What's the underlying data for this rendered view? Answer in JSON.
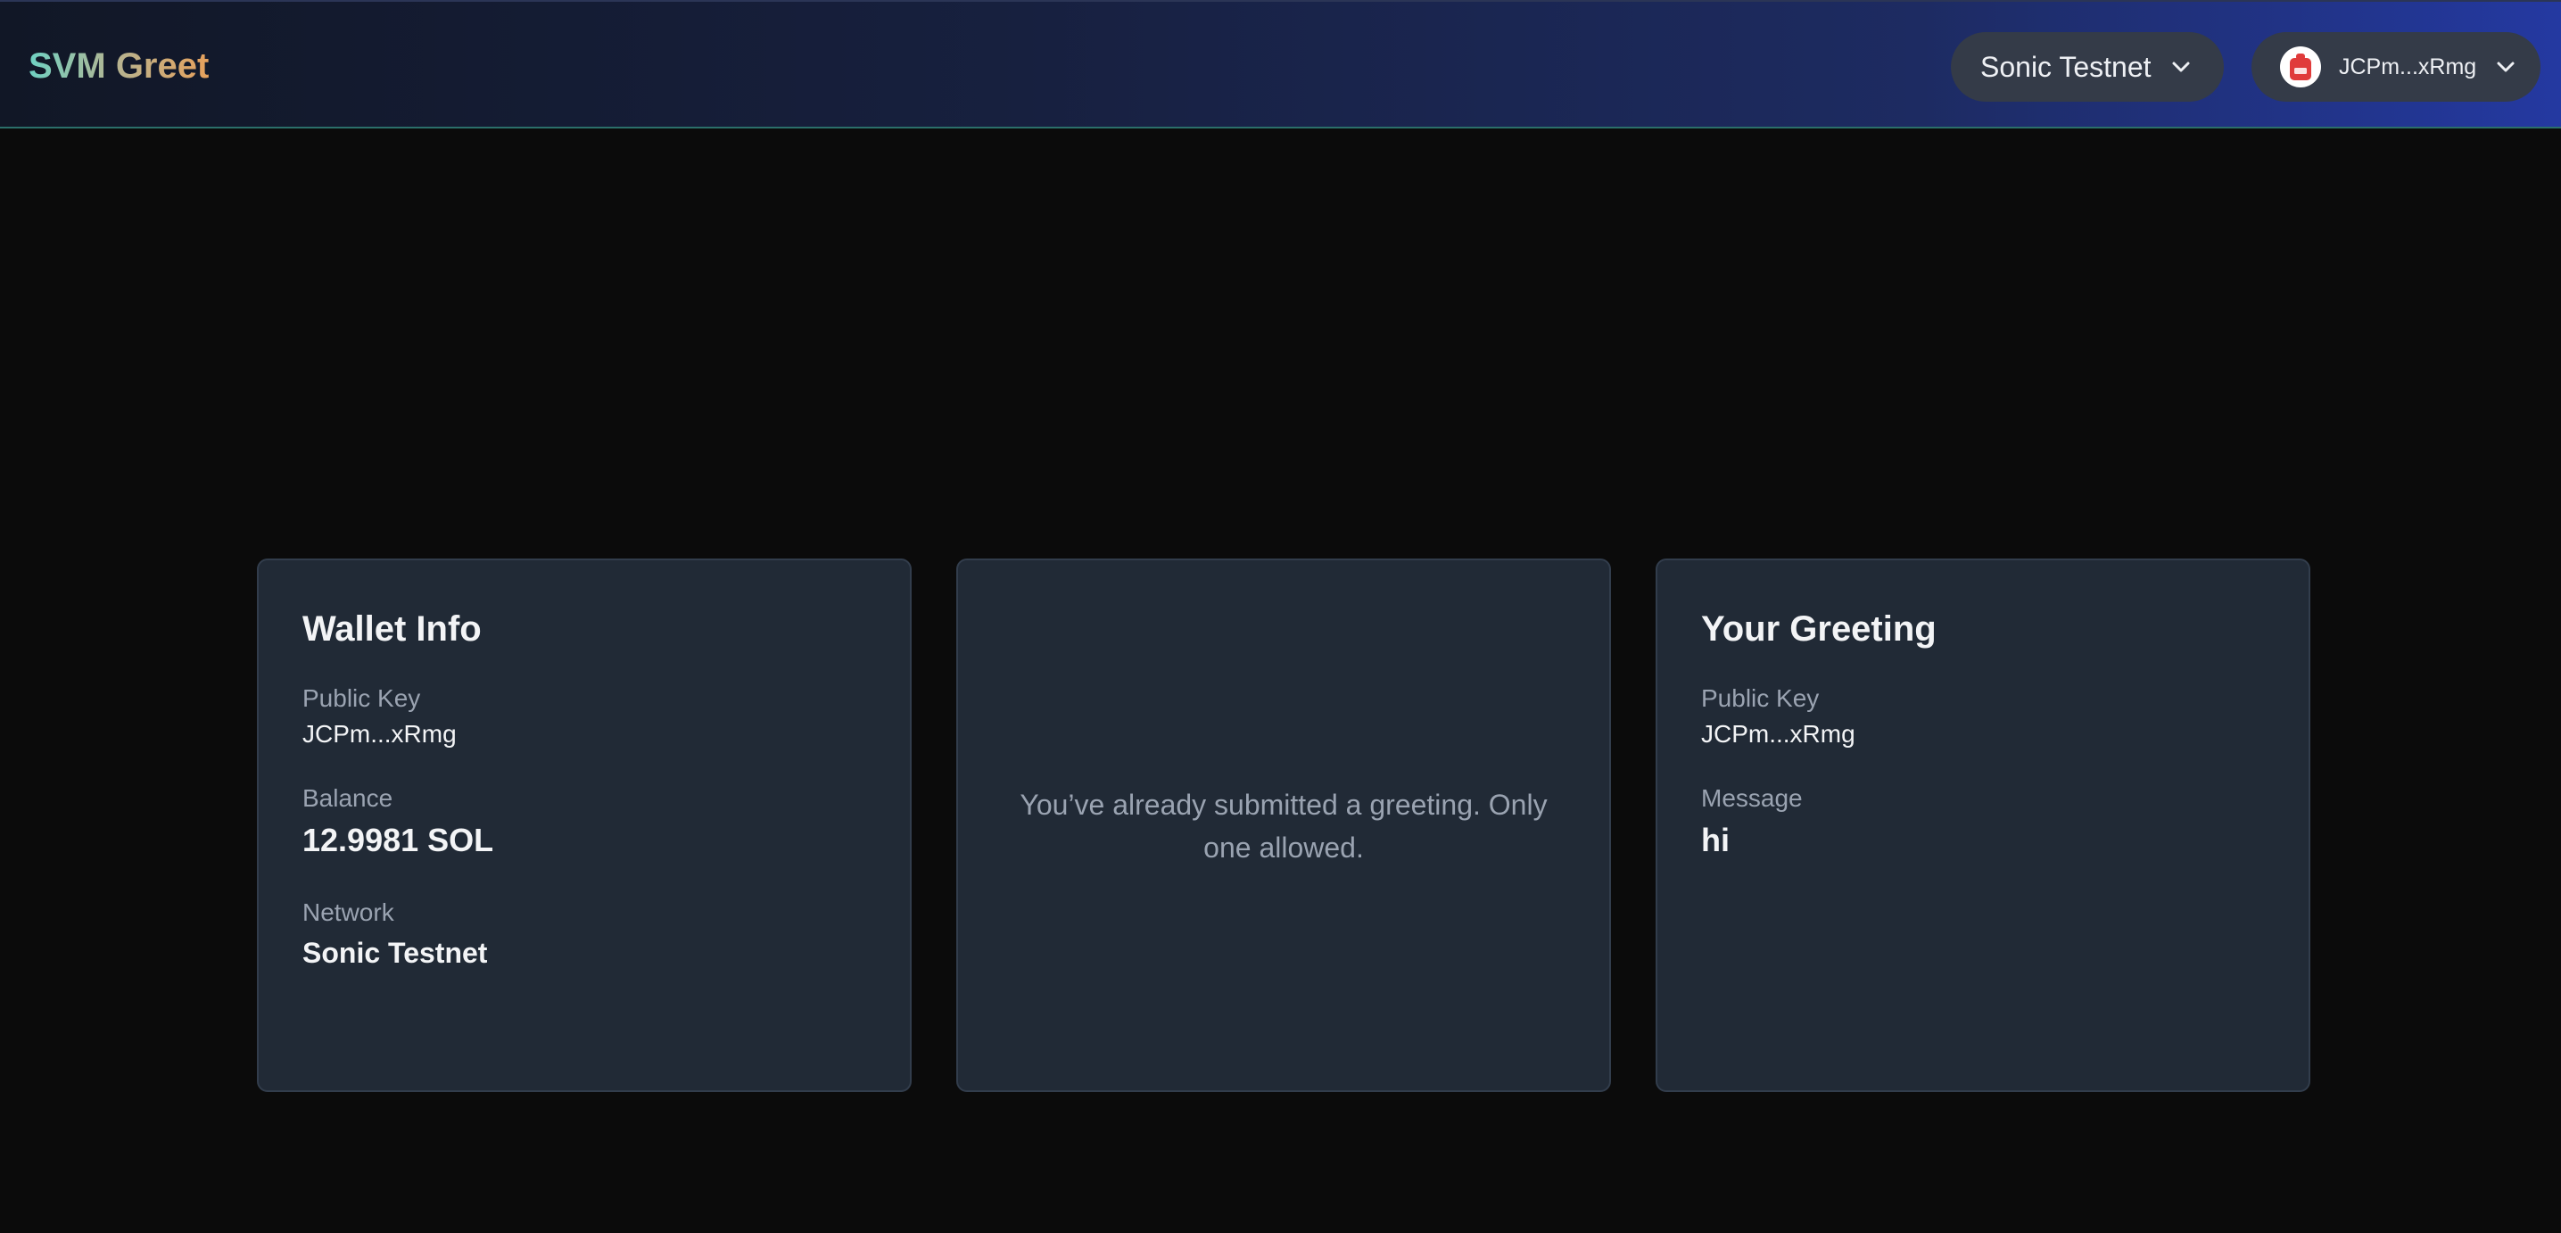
{
  "header": {
    "logo_part1": "SVM",
    "logo_part2": "Greet",
    "network_selector": {
      "label": "Sonic Testnet",
      "icon": "chevron-down-icon"
    },
    "wallet_button": {
      "label": "JCPm...xRmg",
      "avatar_icon": "backpack-wallet-icon",
      "icon": "chevron-down-icon"
    }
  },
  "wallet_info": {
    "title": "Wallet Info",
    "public_key_label": "Public Key",
    "public_key_value": "JCPm...xRmg",
    "balance_label": "Balance",
    "balance_value": "12.9981 SOL",
    "network_label": "Network",
    "network_value": "Sonic Testnet"
  },
  "status_card": {
    "message": "You’ve already submitted a greeting. Only one allowed."
  },
  "your_greeting": {
    "title": "Your Greeting",
    "public_key_label": "Public Key",
    "public_key_value": "JCPm...xRmg",
    "message_label": "Message",
    "message_value": "hi"
  },
  "colors": {
    "background": "#0b0b0b",
    "card_background": "#212a36",
    "pill_background": "#343b48",
    "muted_text": "#9aa3b1",
    "logo_gradient_start": "#6fd1c3",
    "logo_gradient_end": "#e6a15c",
    "wallet_icon_red": "#e03b3b"
  }
}
